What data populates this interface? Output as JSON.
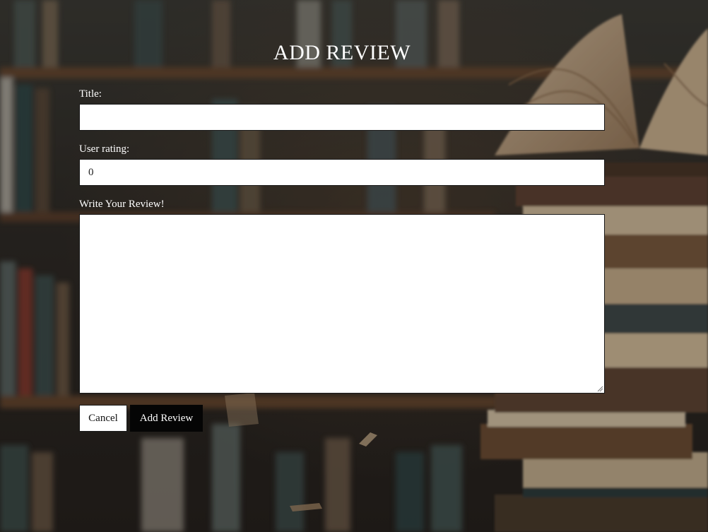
{
  "page": {
    "title": "ADD REVIEW"
  },
  "form": {
    "title_label": "Title:",
    "title_value": "",
    "rating_label": "User rating:",
    "rating_value": "0",
    "review_label": "Write Your Review!",
    "review_value": ""
  },
  "actions": {
    "cancel_label": "Cancel",
    "submit_label": "Add Review"
  },
  "colors": {
    "submit_button_bg": "#050505",
    "cancel_button_bg": "#ffffff",
    "text_on_background": "#ffffff"
  }
}
